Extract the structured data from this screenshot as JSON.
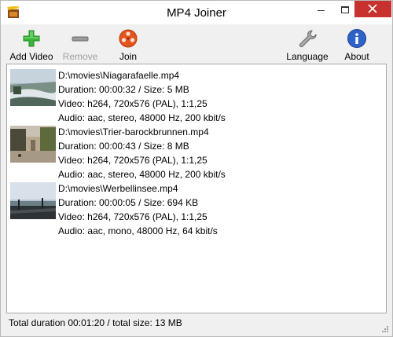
{
  "window": {
    "title": "MP4 Joiner"
  },
  "toolbar": {
    "add_label": "Add Video",
    "remove_label": "Remove",
    "join_label": "Join",
    "language_label": "Language",
    "about_label": "About"
  },
  "files": [
    {
      "path": "D:\\movies\\Niagarafaelle.mp4",
      "duration": "Duration: 00:00:32 / Size: 5 MB",
      "video": "Video: h264, 720x576 (PAL), 1:1,25",
      "audio": "Audio: aac, stereo, 48000 Hz, 200 kbit/s"
    },
    {
      "path": "D:\\movies\\Trier-barockbrunnen.mp4",
      "duration": "Duration: 00:00:43 / Size: 8 MB",
      "video": "Video: h264, 720x576 (PAL), 1:1,25",
      "audio": "Audio: aac, stereo, 48000 Hz, 200 kbit/s"
    },
    {
      "path": "D:\\movies\\Werbellinsee.mp4",
      "duration": "Duration: 00:00:05 / Size: 694 KB",
      "video": "Video: h264, 720x576 (PAL), 1:1,25",
      "audio": "Audio: aac, mono, 48000 Hz, 64 kbit/s"
    }
  ],
  "status": {
    "text": "Total duration 00:01:20 / total size: 13 MB"
  },
  "icons": {
    "add": "plus-icon",
    "remove": "minus-icon",
    "join": "film-reel-icon",
    "language": "wrench-icon",
    "about": "info-icon"
  },
  "colors": {
    "close_button": "#c7312e",
    "add_green": "#3cb43c",
    "join_orange": "#e4541e",
    "about_blue": "#2f62c8"
  }
}
